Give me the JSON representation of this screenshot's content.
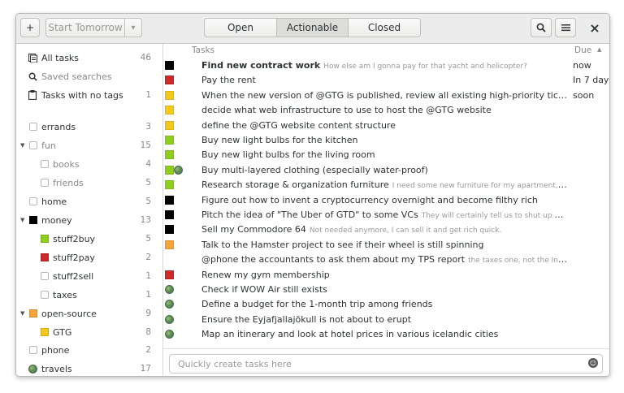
{
  "toolbar": {
    "add_label": "+",
    "start_tomorrow_label": "Start Tomorrow",
    "dropdown_glyph": "▾",
    "tabs": [
      "Open",
      "Actionable",
      "Closed"
    ],
    "active_tab": "Actionable",
    "search_glyph": "⚲",
    "menu_glyph": "≡",
    "close_glyph": "×"
  },
  "sidebar": {
    "items": [
      {
        "label": "All tasks",
        "count": "46",
        "icon": "all-tasks-icon"
      },
      {
        "label": "Saved searches",
        "count": "",
        "icon": "search-icon"
      },
      {
        "label": "Tasks with no tags",
        "count": "1",
        "icon": "no-tags-icon"
      },
      {
        "label": "errands",
        "count": "3",
        "color": ""
      },
      {
        "label": "fun",
        "count": "15",
        "color": "",
        "expanded": true
      },
      {
        "label": "books",
        "count": "4",
        "color": "",
        "child": true
      },
      {
        "label": "friends",
        "count": "5",
        "color": "",
        "child": true
      },
      {
        "label": "home",
        "count": "5",
        "color": ""
      },
      {
        "label": "money",
        "count": "13",
        "color": "#000000",
        "expanded": true
      },
      {
        "label": "stuff2buy",
        "count": "5",
        "color": "#8fce1f",
        "child": true
      },
      {
        "label": "stuff2pay",
        "count": "2",
        "color": "#cc2a2a",
        "child": true
      },
      {
        "label": "stuff2sell",
        "count": "1",
        "color": "",
        "child": true
      },
      {
        "label": "taxes",
        "count": "1",
        "color": "",
        "child": true
      },
      {
        "label": "open-source",
        "count": "9",
        "color": "#f5a53a",
        "expanded": true
      },
      {
        "label": "GTG",
        "count": "8",
        "color": "#f5c918",
        "child": true
      },
      {
        "label": "phone",
        "count": "2",
        "color": ""
      },
      {
        "label": "travels",
        "count": "17",
        "icon": "globe-icon"
      }
    ]
  },
  "tasks": {
    "header_title": "Tasks",
    "header_due": "Due",
    "sort_glyph": "▲",
    "rows": [
      {
        "title": "Find new contract work",
        "bold": true,
        "note": "How else am I gonna pay for that yacht and helicopter?",
        "due": "now",
        "tags": [
          "#000000"
        ]
      },
      {
        "title": "Pay the rent",
        "note": "",
        "due": "In 7 days",
        "tags": [
          "#cc2a2a"
        ]
      },
      {
        "title": "When the new version of @GTG is published, review all existing high-priority tickets",
        "note": "",
        "due": "soon",
        "tags": [
          "#f5c918"
        ]
      },
      {
        "title": "decide what web infrastructure to use to host the @GTG website",
        "note": "",
        "due": "",
        "tags": [
          "#f5c918"
        ]
      },
      {
        "title": "define the @GTG website content structure",
        "note": "",
        "due": "",
        "tags": [
          "#f5c918"
        ]
      },
      {
        "title": "Buy new light bulbs for the kitchen",
        "note": "",
        "due": "",
        "tags": [
          "#8fce1f"
        ]
      },
      {
        "title": "Buy new light bulbs for the living room",
        "note": "",
        "due": "",
        "tags": [
          "#8fce1f"
        ]
      },
      {
        "title": "Buy multi-layered clothing (especially water-proof)",
        "note": "",
        "due": "",
        "tags": [
          "#8fce1f",
          "globe"
        ]
      },
      {
        "title": "Research storage & organization furniture",
        "note": "I need some new furniture for my apartment, I don't have en…",
        "due": "",
        "tags": [
          "#8fce1f"
        ]
      },
      {
        "title": "Figure out how to invent a cryptocurrency overnight and become filthy rich",
        "note": "",
        "due": "",
        "tags": [
          "#000000"
        ]
      },
      {
        "title": "Pitch the idea of \"The Uber of GTD\" to some VCs",
        "note": "They will certainly tell us to shut up and take their mo…",
        "due": "",
        "tags": [
          "#000000"
        ]
      },
      {
        "title": "Sell my Commodore 64",
        "note": "Not needed anymore, I can sell it and get rich quick.",
        "due": "",
        "tags": [
          "#000000"
        ]
      },
      {
        "title": "Talk to the Hamster project to see if their wheel is still spinning",
        "note": "",
        "due": "",
        "tags": [
          "#f5a53a"
        ]
      },
      {
        "title": "@phone the accountants to ask them about my TPS report",
        "note": "the taxes one, not the Initech one",
        "due": "",
        "tags": []
      },
      {
        "title": "Renew my gym membership",
        "note": "",
        "due": "",
        "tags": [
          "#cc2a2a"
        ]
      },
      {
        "title": "Check if WOW Air still exists",
        "note": "",
        "due": "",
        "tags": [
          "globe"
        ]
      },
      {
        "title": "Define a budget for the 1-month trip among friends",
        "note": "",
        "due": "",
        "tags": [
          "globe"
        ]
      },
      {
        "title": "Ensure the Eyjafjallajökull is not about to erupt",
        "note": "",
        "due": "",
        "tags": [
          "globe"
        ]
      },
      {
        "title": "Map an itinerary and look at hotel prices in various icelandic cities",
        "note": "",
        "due": "",
        "tags": [
          "globe"
        ]
      }
    ]
  },
  "quick_add": {
    "placeholder": "Quickly create tasks here",
    "emoji_glyph": "☺"
  }
}
